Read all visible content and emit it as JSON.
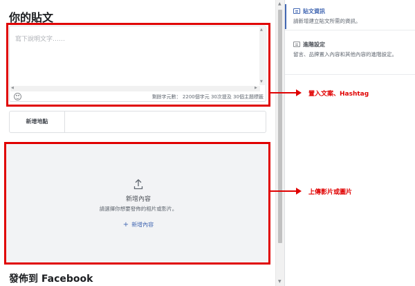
{
  "post": {
    "title": "你的貼文",
    "caption_placeholder": "寫下說明文字……",
    "char_remaining": "剩餘字元數： 2200個字元 30次提及 30個主題標籤",
    "location_label": "新增地點",
    "media": {
      "title": "新增內容",
      "hint": "請選擇你想要發佈的相片或影片。",
      "add_button": "新增內容"
    },
    "publish_title": "發佈到 Facebook"
  },
  "steps": [
    {
      "title": "貼文資訊",
      "desc": "請新增建立貼文所需的資訊。",
      "active": true
    },
    {
      "title": "進階設定",
      "desc": "留言、品牌置入內容和其他內容的進階設定。",
      "active": false
    }
  ],
  "annotations": {
    "caption_note": "置入文案、Hashtag",
    "media_note": "上傳影片或圖片"
  },
  "colors": {
    "highlight_frame": "#e00000",
    "accent": "#4267b2"
  }
}
